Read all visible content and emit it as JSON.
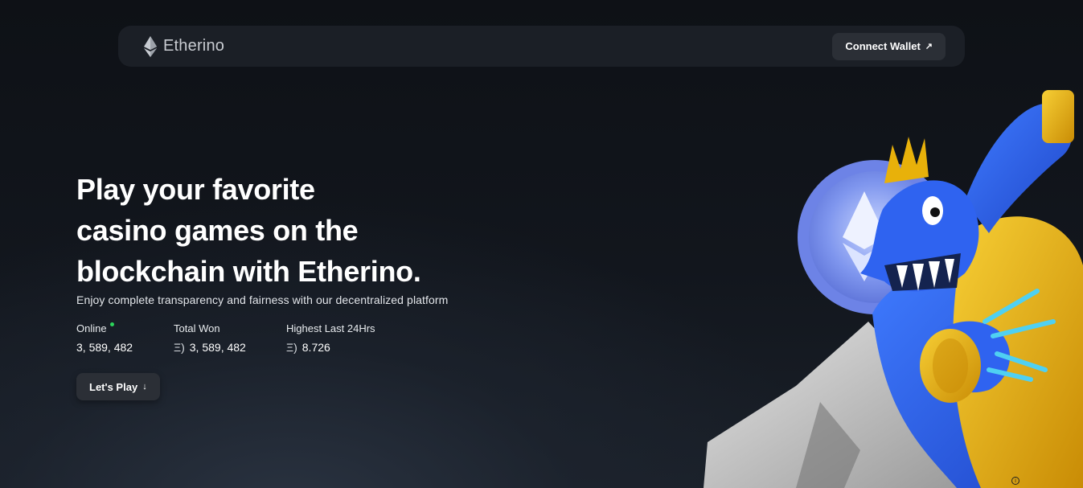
{
  "nav": {
    "brand": "Etherino",
    "connect_label": "Connect Wallet",
    "connect_arrow": "↗"
  },
  "hero": {
    "headline_lines": [
      "Play your favorite",
      "casino games on the",
      "blockchain with Etherino."
    ],
    "subline": "Enjoy complete transparency and fairness with our decentralized platform",
    "stats": {
      "online": {
        "label": "Online",
        "value": "3, 589, 482"
      },
      "total_won": {
        "label": "Total Won",
        "symbol": "Ξ)",
        "value": "3, 589, 482"
      },
      "highest": {
        "label": "Highest Last 24Hrs",
        "symbol": "Ξ)",
        "value": "8.726"
      }
    },
    "play_label": "Let's Play",
    "play_arrow": "↓"
  },
  "icons": {
    "brand": "ethereum-logo-icon",
    "connect": "arrow-up-right-icon",
    "play": "arrow-down-icon",
    "online": "status-dot-icon",
    "info": "info-icon"
  },
  "colors": {
    "background": "#0e1116",
    "nav_bg": "#1b1f26",
    "button_bg": "#2b2f36",
    "online_dot": "#2bd45a",
    "mascot_blue": "#2f5fe0",
    "gold": "#e8b10a"
  }
}
